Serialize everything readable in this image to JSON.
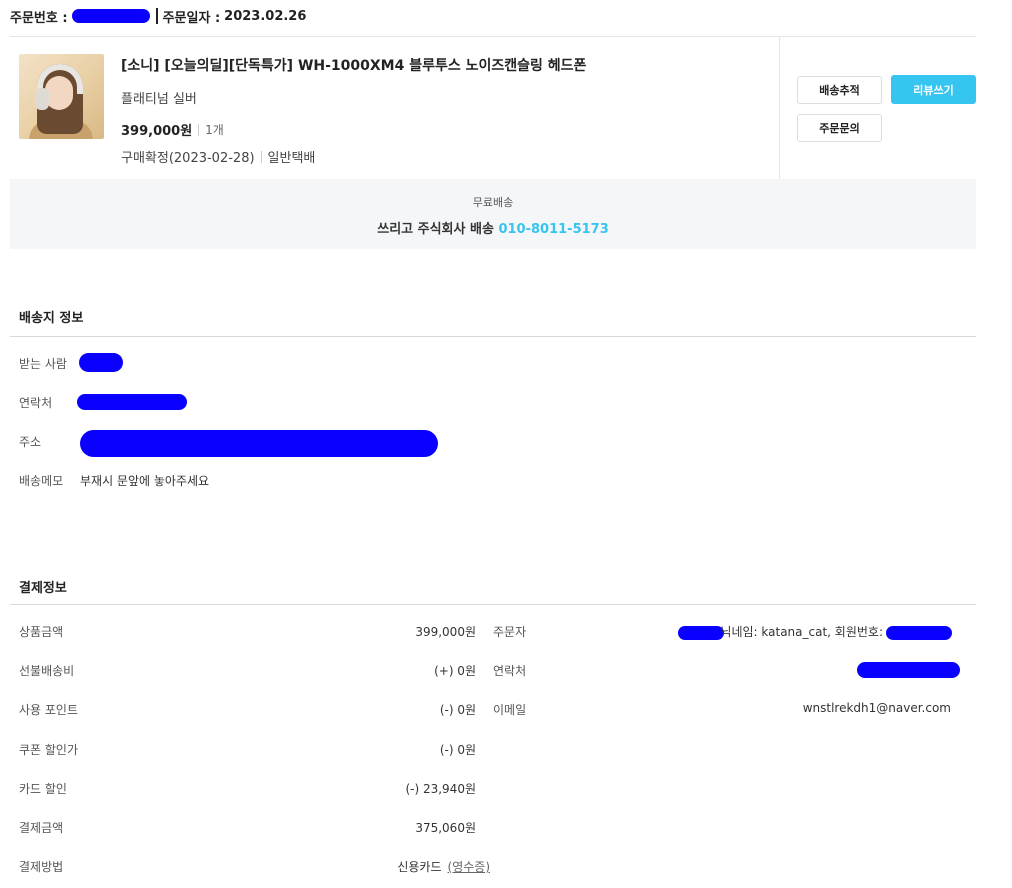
{
  "order": {
    "number_label": "주문번호 :",
    "date_label": "주문일자 :",
    "date_value": "2023.02.26"
  },
  "product": {
    "title": "[소니] [오늘의딜][단독특가] WH-1000XM4 블루투스 노이즈캔슬링 헤드폰",
    "option": "플래티넘 실버",
    "price": "399,000원",
    "quantity": "1개",
    "status": "구매확정(2023-02-28)",
    "delivery_type": "일반택배"
  },
  "buttons": {
    "track": "배송추적",
    "review": "리뷰쓰기",
    "inquiry": "주문문의"
  },
  "shipping": {
    "fee": "무료배송",
    "carrier": "쓰리고 주식회사 배송",
    "phone": "010-8011-5173"
  },
  "delivery_info": {
    "title": "배송지 정보",
    "rows": [
      {
        "label": "받는 사람"
      },
      {
        "label": "연락처"
      },
      {
        "label": "주소"
      },
      {
        "label": "배송메모",
        "value": "부재시 문앞에 놓아주세요"
      }
    ]
  },
  "payment": {
    "title": "결제정보",
    "rows": [
      {
        "label": "상품금액",
        "value": "399,000원"
      },
      {
        "label": "선불배송비",
        "value": "(+) 0원"
      },
      {
        "label": "사용 포인트",
        "value": "(-) 0원"
      },
      {
        "label": "쿠폰 할인가",
        "value": "(-) 0원"
      },
      {
        "label": "카드 할인",
        "value": "(-) 23,940원"
      },
      {
        "label": "결제금액",
        "value": "375,060원"
      },
      {
        "label": "결제방법",
        "value": "신용카드",
        "link": "(영수증)"
      }
    ]
  },
  "buyer": {
    "rows": [
      {
        "label": "주문자",
        "value_suffix": "닉네임: katana_cat, 회원번호:"
      },
      {
        "label": "연락처"
      },
      {
        "label": "이메일",
        "value": "wnstlrekdh1@naver.com"
      }
    ]
  },
  "colors": {
    "accent": "#35c5f0",
    "redaction": "#0a00ff"
  }
}
